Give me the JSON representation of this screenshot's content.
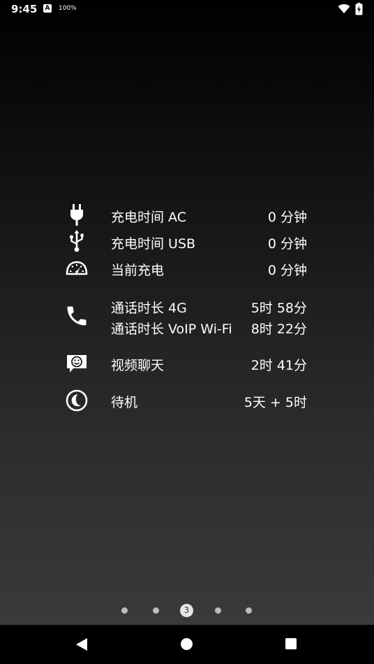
{
  "status_bar": {
    "time": "9:45",
    "notification_icon": "A",
    "battery_percent": "100%",
    "icons": [
      "wifi-icon",
      "battery-charging-icon"
    ]
  },
  "stats": [
    {
      "icon": "plug-icon",
      "label": "充电时间 AC",
      "value": "0 分钟"
    },
    {
      "icon": "usb-icon",
      "label": "充电时间 USB",
      "value": "0 分钟"
    },
    {
      "icon": "speedometer-icon",
      "label": "当前充电",
      "value": "0 分钟"
    },
    {
      "icon": "phone-icon",
      "label": "通话时长 4G",
      "value": "5时 58分",
      "label2": "通话时长 VoIP Wi-Fi",
      "value2": "8时 22分"
    },
    {
      "icon": "video-chat-icon",
      "label": "视频聊天",
      "value": "2时 41分"
    },
    {
      "icon": "standby-moon-icon",
      "label": "待机",
      "value": "5天 + 5时"
    }
  ],
  "pager": {
    "active_page": "3",
    "total_pages": 5
  },
  "colors": {
    "background_top": "#000000",
    "background_bottom": "#3d3d3d",
    "text": "#ffffff",
    "dot_inactive": "#bdbdbd"
  }
}
